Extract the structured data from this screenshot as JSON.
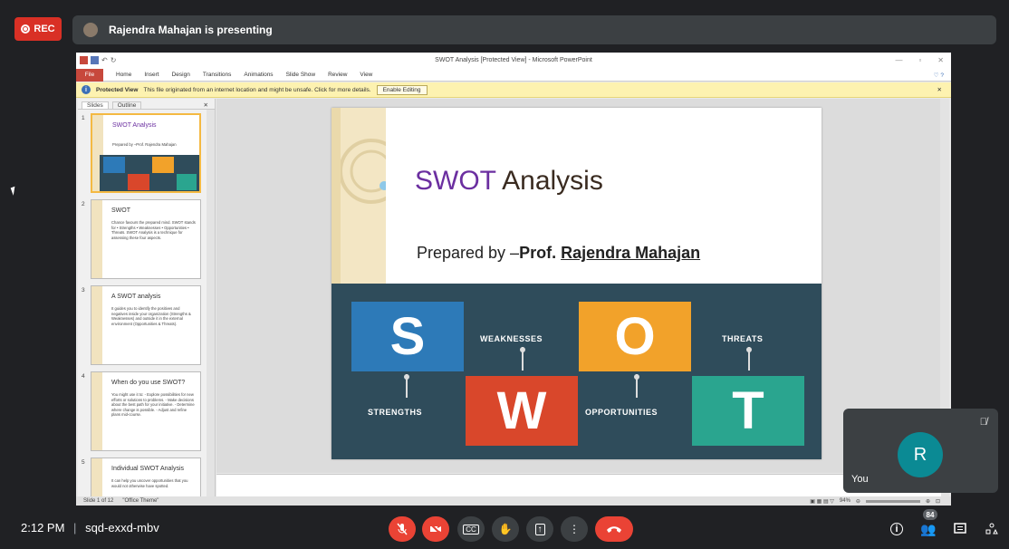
{
  "meet": {
    "rec_label": "REC",
    "presenting_text": "Rajendra Mahajan is presenting",
    "time": "2:12 PM",
    "separator": "|",
    "meeting_code": "sqd-exxd-mbv",
    "participants_count": "84",
    "self_initial": "R",
    "self_label": "You",
    "colors": {
      "rec": "#d93025",
      "end_call": "#ea4335",
      "avatar": "#0b8a94"
    }
  },
  "ppt": {
    "window_title": "SWOT Analysis [Protected View] - Microsoft PowerPoint",
    "ribbon_tabs": [
      "File",
      "Home",
      "Insert",
      "Design",
      "Transitions",
      "Animations",
      "Slide Show",
      "Review",
      "View"
    ],
    "protected_label": "Protected View",
    "protected_message": "This file originated from an internet location and might be unsafe. Click for more details.",
    "enable_editing": "Enable Editing",
    "pane_tabs": [
      "Slides",
      "Outline"
    ],
    "thumbnails": [
      {
        "num": "1",
        "title": "SWOT Analysis",
        "lines": "Prepared by –Prof. Rajendra Mahajan"
      },
      {
        "num": "2",
        "title": "SWOT",
        "lines": "Chance favours the prepared mind. SWOT stands for • Strengths • Weaknesses • Opportunities • Threats. SWOT Analysis is a technique for assessing these four aspects."
      },
      {
        "num": "3",
        "title": "A SWOT analysis",
        "lines": "It guides you to identify the positives and negatives inside your organization (Strengths & Weaknesses) and outside it in the external environment (Opportunities & Threats)."
      },
      {
        "num": "4",
        "title": "When do you use SWOT?",
        "lines": "You might use it to: - Explore possibilities for new efforts or solutions to problems. - Make decisions about the best path for your initiative. - Determine where change is possible. - Adjust and refine plans mid-course."
      },
      {
        "num": "5",
        "title": "Individual SWOT Analysis",
        "lines": "It can help you uncover opportunities that you would not otherwise have spotted."
      }
    ],
    "status_slide": "Slide 1 of 12",
    "status_theme": "\"Office Theme\"",
    "zoom": "94%",
    "slide": {
      "title_swot": "SWOT",
      "title_rest": " Analysis",
      "prepared_by": "Prepared by –",
      "prof": "Prof. ",
      "name": "Rajendra Mahajan",
      "letters": {
        "s": "S",
        "w": "W",
        "o": "O",
        "t": "T"
      },
      "labels": {
        "strengths": "STRENGTHS",
        "weaknesses": "WEAKNESSES",
        "opportunities": "OPPORTUNITIES",
        "threats": "THREATS"
      },
      "colors": {
        "s": "#2d7ab8",
        "w": "#d9472b",
        "o": "#f2a22a",
        "t": "#2aa58f",
        "bg": "#2f4c5b"
      }
    }
  },
  "icons": {
    "mic_off": "mic-off-icon",
    "cam_off": "camera-off-icon",
    "cc": "captions-icon",
    "hand": "raise-hand-icon",
    "present": "present-icon",
    "more": "more-vert-icon",
    "end": "end-call-icon",
    "info": "info-icon",
    "people": "people-icon",
    "chat": "chat-icon",
    "activities": "activities-icon"
  }
}
